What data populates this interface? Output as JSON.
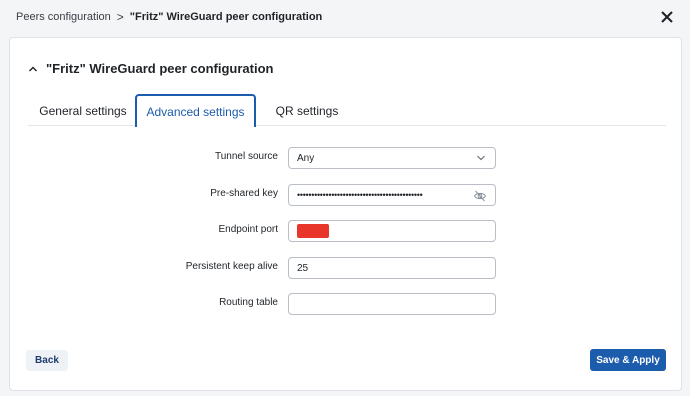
{
  "breadcrumb": {
    "parent": "Peers configuration",
    "separator": ">",
    "current": "\"Fritz\" WireGuard peer configuration"
  },
  "section": {
    "title": "\"Fritz\" WireGuard peer configuration"
  },
  "tabs": [
    {
      "label": "General settings",
      "active": false
    },
    {
      "label": "Advanced settings",
      "active": true
    },
    {
      "label": "QR settings",
      "active": false
    }
  ],
  "form": {
    "tunnel_source": {
      "label": "Tunnel source",
      "value": "Any"
    },
    "pre_shared_key": {
      "label": "Pre-shared key",
      "value": "••••••••••••••••••••••••••••••••••••••••••••"
    },
    "endpoint_port": {
      "label": "Endpoint port",
      "value": ""
    },
    "persistent_keep_alive": {
      "label": "Persistent keep alive",
      "value": "25"
    },
    "routing_table": {
      "label": "Routing table",
      "value": ""
    }
  },
  "buttons": {
    "back": "Back",
    "save_apply": "Save & Apply"
  },
  "colors": {
    "accent": "#1c5cad",
    "redaction": "#e8362a"
  }
}
